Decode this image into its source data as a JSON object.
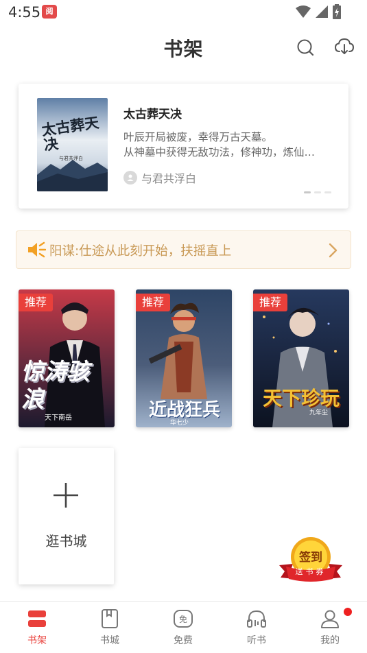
{
  "status_bar": {
    "time": "4:55",
    "notif_badge": "阅"
  },
  "header": {
    "title": "书架"
  },
  "featured": {
    "title": "太古葬天决",
    "desc_line1": "叶辰开局被废，幸得万古天墓。",
    "desc_line2": "从神墓中获得无敌功法，修神功，炼仙…",
    "author": "与君共浮白",
    "cover_text": "太古葬天决",
    "cover_author": "与君共浮白",
    "page_count": 3,
    "active_page": 1
  },
  "notice": {
    "text": "阳谋:仕途从此刻开始，扶摇直上"
  },
  "books": [
    {
      "tag": "推荐",
      "cover_title": "惊涛骇浪",
      "cover_author": "天下南岳"
    },
    {
      "tag": "推荐",
      "cover_title": "近战狂兵",
      "cover_author": "华七少"
    },
    {
      "tag": "推荐",
      "cover_title": "天下珍玩",
      "cover_author": "九年尘"
    }
  ],
  "add_card": {
    "label": "逛书城"
  },
  "checkin": {
    "line1": "签到",
    "line2": "送书券"
  },
  "nav": [
    {
      "label": "书架",
      "icon": "bookshelf-icon",
      "active": true
    },
    {
      "label": "书城",
      "icon": "bookstore-icon",
      "active": false
    },
    {
      "label": "免费",
      "icon": "free-icon",
      "active": false
    },
    {
      "label": "听书",
      "icon": "headphones-icon",
      "active": false
    },
    {
      "label": "我的",
      "icon": "profile-icon",
      "active": false
    }
  ],
  "colors": {
    "accent": "#e9403b",
    "notice_text": "#c99a57",
    "notice_bg": "#fdf7ef"
  }
}
